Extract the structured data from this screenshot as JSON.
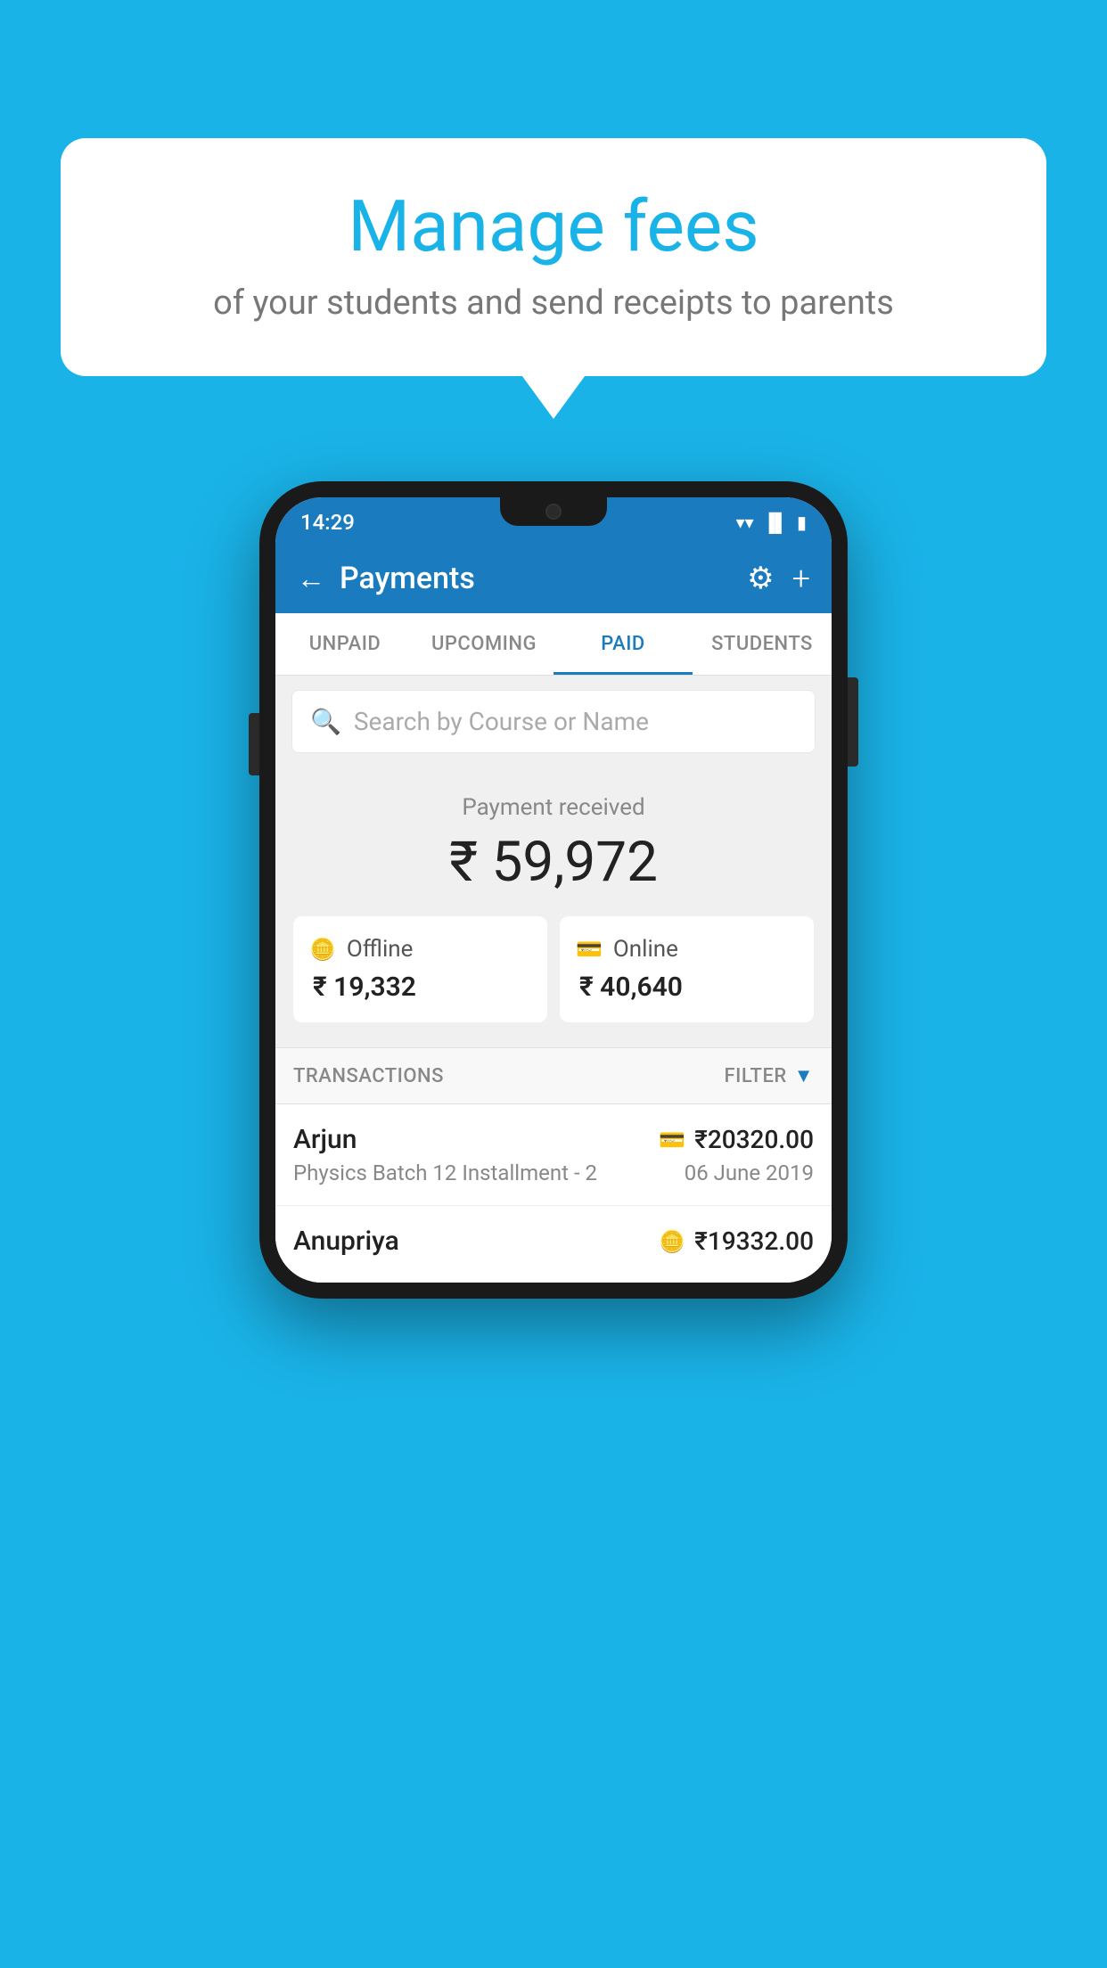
{
  "background_color": "#1ab3e8",
  "speech_bubble": {
    "title": "Manage fees",
    "subtitle": "of your students and send receipts to parents"
  },
  "phone": {
    "status_bar": {
      "time": "14:29",
      "icons": [
        "wifi",
        "signal",
        "battery"
      ]
    },
    "app_bar": {
      "title": "Payments",
      "back_label": "←",
      "settings_label": "⚙",
      "add_label": "+"
    },
    "tabs": [
      {
        "label": "UNPAID",
        "active": false
      },
      {
        "label": "UPCOMING",
        "active": false
      },
      {
        "label": "PAID",
        "active": true
      },
      {
        "label": "STUDENTS",
        "active": false
      }
    ],
    "search": {
      "placeholder": "Search by Course or Name"
    },
    "payment_summary": {
      "label": "Payment received",
      "total": "₹ 59,972",
      "offline_label": "Offline",
      "offline_amount": "₹ 19,332",
      "online_label": "Online",
      "online_amount": "₹ 40,640"
    },
    "transactions": {
      "section_label": "TRANSACTIONS",
      "filter_label": "FILTER",
      "items": [
        {
          "name": "Arjun",
          "course": "Physics Batch 12 Installment - 2",
          "amount": "₹20320.00",
          "date": "06 June 2019",
          "payment_type": "card"
        },
        {
          "name": "Anupriya",
          "course": "",
          "amount": "₹19332.00",
          "date": "",
          "payment_type": "offline"
        }
      ]
    }
  }
}
